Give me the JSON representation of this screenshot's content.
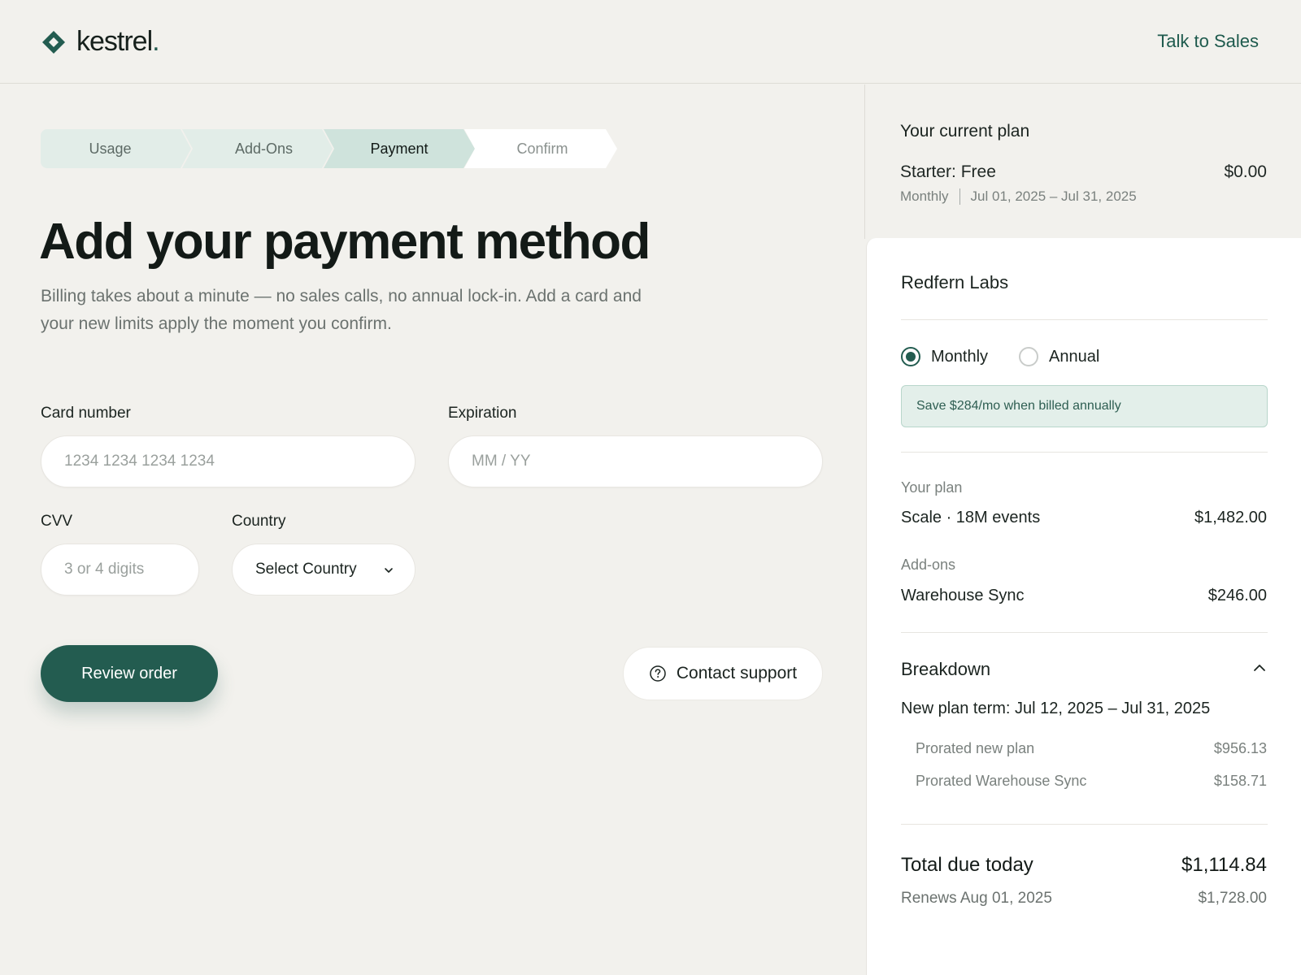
{
  "header": {
    "brand": "kestrel",
    "brand_dot": ".",
    "talk_to_sales": "Talk to Sales"
  },
  "stepper": {
    "steps": [
      {
        "label": "Usage",
        "state": "done"
      },
      {
        "label": "Add-Ons",
        "state": "done"
      },
      {
        "label": "Payment",
        "state": "current"
      },
      {
        "label": "Confirm",
        "state": "upcoming"
      }
    ]
  },
  "main": {
    "title": "Add your payment method",
    "subtitle": "Billing takes about a minute — no sales calls, no annual lock-in. Add a card and your new limits apply the moment you confirm."
  },
  "form": {
    "card_number": {
      "label": "Card number",
      "placeholder": "1234 1234 1234 1234",
      "value": ""
    },
    "expiration": {
      "label": "Expiration",
      "placeholder": "MM / YY",
      "value": ""
    },
    "cvv": {
      "label": "CVV",
      "placeholder": "3 or 4 digits",
      "value": ""
    },
    "country": {
      "label": "Country",
      "selected": "Select Country"
    },
    "review_button": "Review order",
    "support_button": "Contact support"
  },
  "current_plan": {
    "heading": "Your current plan",
    "name": "Starter: Free",
    "price": "$0.00",
    "cycle": "Monthly",
    "period": "Jul 01, 2025 – Jul 31, 2025"
  },
  "summary": {
    "org": "Redfern Labs",
    "billing_options": [
      {
        "label": "Monthly",
        "selected": true
      },
      {
        "label": "Annual",
        "selected": false
      }
    ],
    "save_banner": "Save $284/mo when billed annually",
    "plan_label": "Your plan",
    "plan_name": "Scale · 18M events",
    "plan_price": "$1,482.00",
    "addons_label": "Add-ons",
    "addon_name": "Warehouse Sync",
    "addon_price": "$246.00",
    "breakdown_title": "Breakdown",
    "term": "New plan term: Jul 12, 2025 – Jul 31, 2025",
    "breakdown_items": [
      {
        "name": "Prorated new plan",
        "value": "$956.13"
      },
      {
        "name": "Prorated Warehouse Sync",
        "value": "$158.71"
      }
    ],
    "total_label": "Total due today",
    "total_value": "$1,114.84",
    "renew_label": "Renews Aug 01, 2025",
    "renew_value": "$1,728.00"
  },
  "colors": {
    "brand": "#235c50",
    "background": "#f2f1ed",
    "step_done": "#e2ede8",
    "step_current": "#cfe3dc",
    "banner_bg": "#e3efea"
  },
  "icons": [
    "kestrel-logo-icon",
    "help-circle-icon",
    "chevron-down-icon",
    "chevron-up-icon"
  ]
}
